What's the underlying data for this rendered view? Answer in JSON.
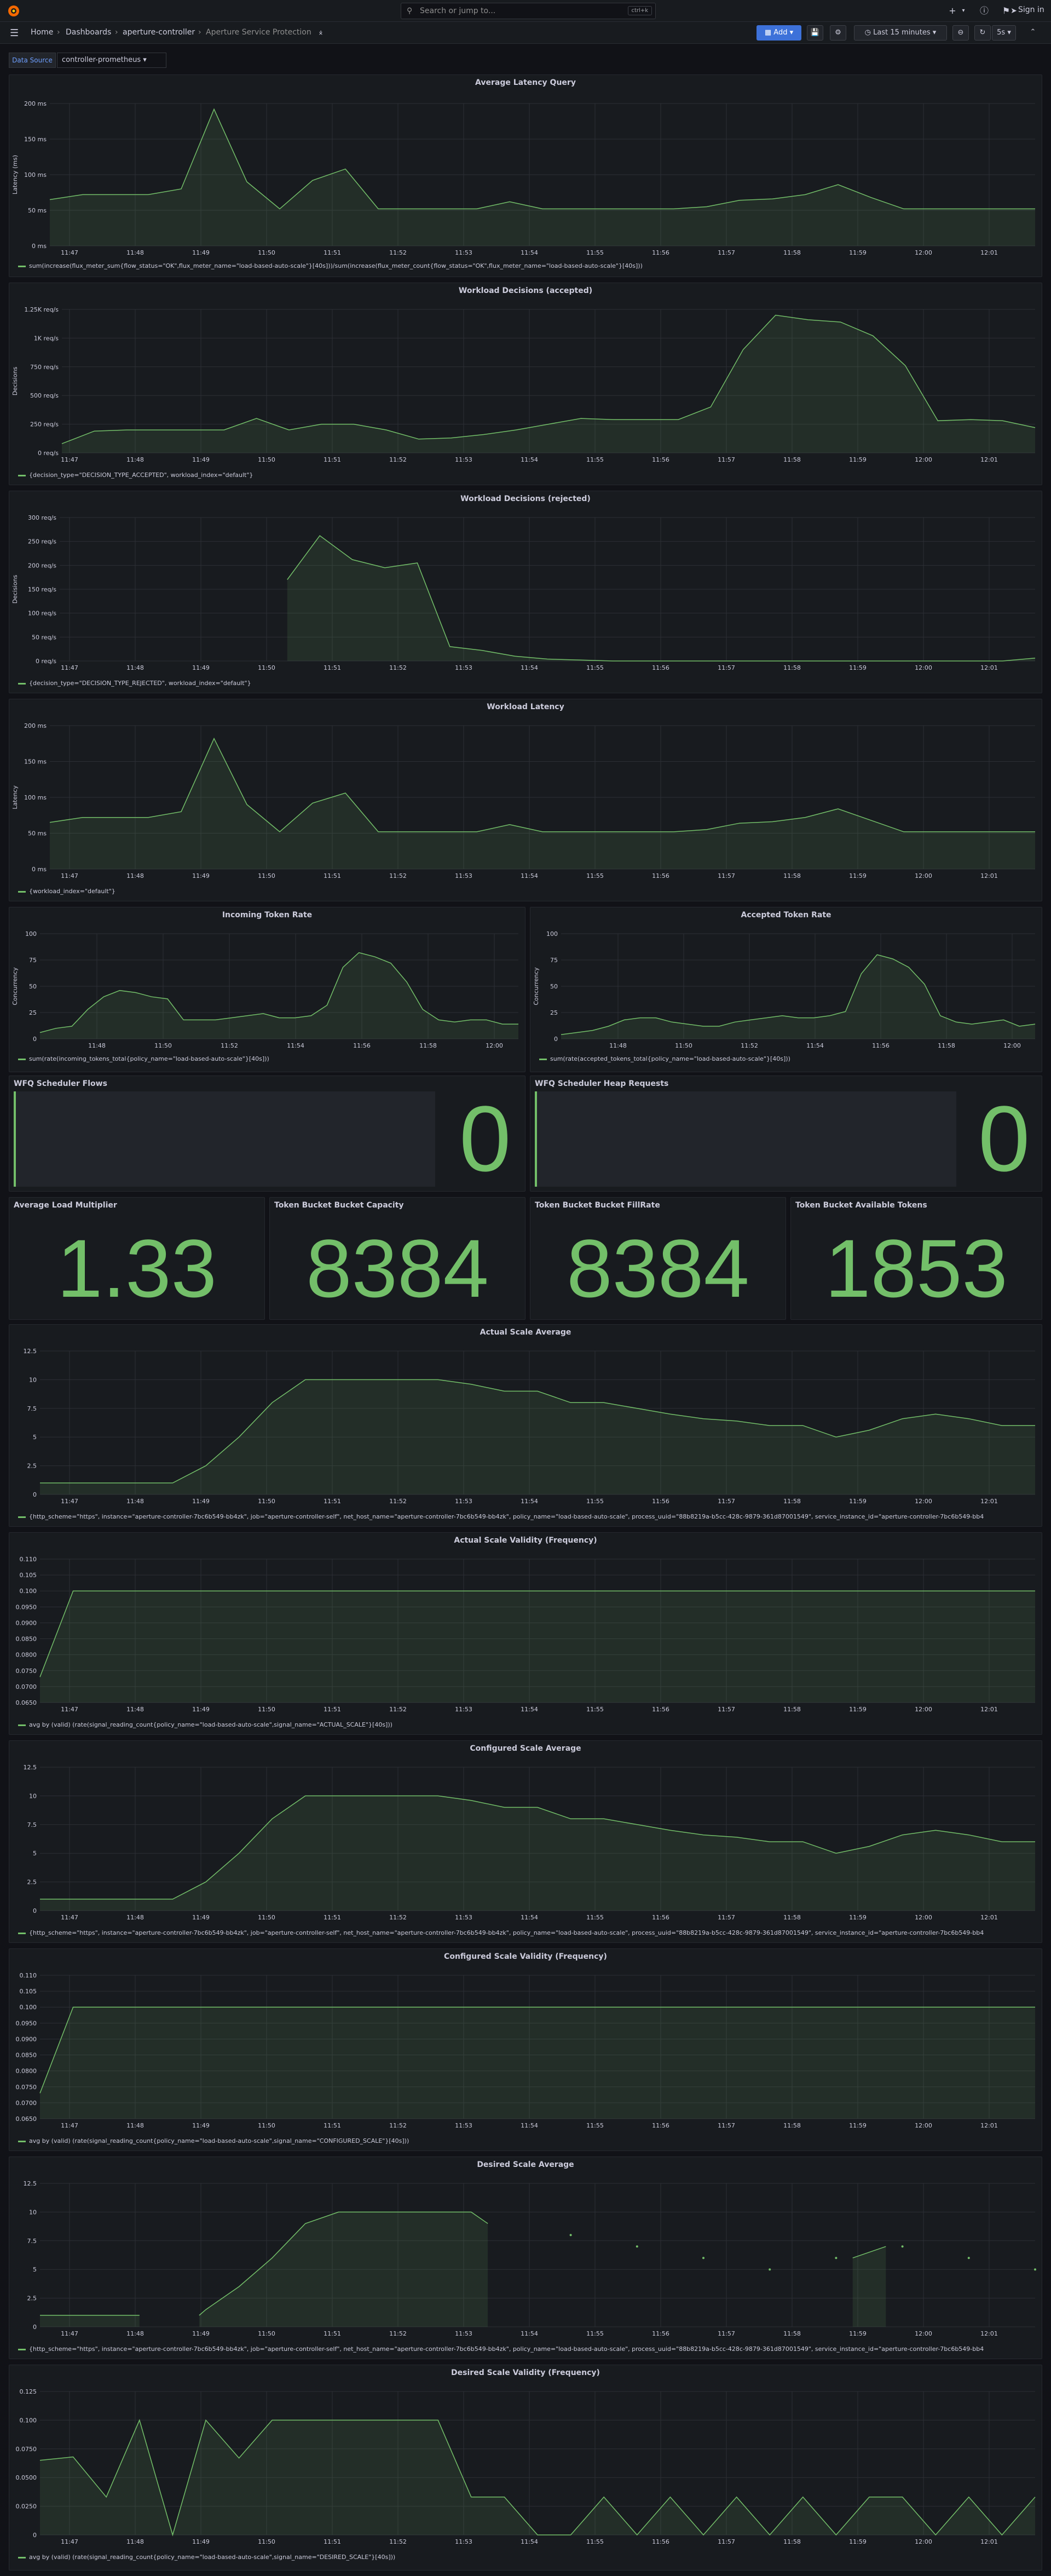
{
  "topnav": {
    "search_placeholder": "Search or jump to...",
    "search_shortcut": "ctrl+k",
    "sign_in": "Sign in"
  },
  "toolbar": {
    "breadcrumbs": [
      "Home",
      "Dashboards",
      "aperture-controller",
      "Aperture Service Protection"
    ],
    "add_label": "Add",
    "time_range": "Last 15 minutes",
    "refresh_interval": "5s"
  },
  "variables": {
    "label": "Data Source",
    "value": "controller-prometheus"
  },
  "colors": {
    "series": "#73bf69",
    "grid": "#2c2f35",
    "text": "#ccccdc",
    "accent": "#6e9fff"
  },
  "time_ticks_hm": [
    "11:47",
    "11:48",
    "11:49",
    "11:50",
    "11:51",
    "11:52",
    "11:53",
    "11:54",
    "11:55",
    "11:56",
    "11:57",
    "11:58",
    "11:59",
    "12:00",
    "12:01"
  ],
  "panels": {
    "avg_latency": {
      "title": "Average Latency Query",
      "legend": "sum(increase(flux_meter_sum{flow_status=\"OK\",flux_meter_name=\"load-based-auto-scale\"}[40s]))/sum(increase(flux_meter_count{flow_status=\"OK\",flux_meter_name=\"load-based-auto-scale\"}[40s]))"
    },
    "decisions_accepted": {
      "title": "Workload Decisions (accepted)",
      "legend": "{decision_type=\"DECISION_TYPE_ACCEPTED\", workload_index=\"default\"}"
    },
    "decisions_rejected": {
      "title": "Workload Decisions (rejected)",
      "legend": "{decision_type=\"DECISION_TYPE_REJECTED\", workload_index=\"default\"}"
    },
    "workload_latency": {
      "title": "Workload Latency",
      "legend": "{workload_index=\"default\"}"
    },
    "incoming_token_rate": {
      "title": "Incoming Token Rate",
      "legend": "sum(rate(incoming_tokens_total{policy_name=\"load-based-auto-scale\"}[40s]))"
    },
    "accepted_token_rate": {
      "title": "Accepted Token Rate",
      "legend": "sum(rate(accepted_tokens_total{policy_name=\"load-based-auto-scale\"}[40s]))"
    },
    "wfq_flows": {
      "title": "WFQ Scheduler Flows",
      "value": "0"
    },
    "wfq_heap": {
      "title": "WFQ Scheduler Heap Requests",
      "value": "0"
    },
    "avg_load_multiplier": {
      "title": "Average Load Multiplier",
      "value": "1.33"
    },
    "bucket_capacity": {
      "title": "Token Bucket Bucket Capacity",
      "value": "8384"
    },
    "bucket_fillrate": {
      "title": "Token Bucket Bucket FillRate",
      "value": "8384"
    },
    "bucket_available": {
      "title": "Token Bucket Available Tokens",
      "value": "1853"
    },
    "actual_scale_avg": {
      "title": "Actual Scale Average",
      "legend": "{http_scheme=\"https\", instance=\"aperture-controller-7bc6b549-bb4zk\", job=\"aperture-controller-self\", net_host_name=\"aperture-controller-7bc6b549-bb4zk\", policy_name=\"load-based-auto-scale\", process_uuid=\"88b8219a-b5cc-428c-9879-361d87001549\", service_instance_id=\"aperture-controller-7bc6b549-bb4"
    },
    "actual_scale_validity": {
      "title": "Actual Scale Validity (Frequency)",
      "legend": "avg by (valid) (rate(signal_reading_count{policy_name=\"load-based-auto-scale\",signal_name=\"ACTUAL_SCALE\"}[40s]))"
    },
    "configured_scale_avg": {
      "title": "Configured Scale Average",
      "legend": "{http_scheme=\"https\", instance=\"aperture-controller-7bc6b549-bb4zk\", job=\"aperture-controller-self\", net_host_name=\"aperture-controller-7bc6b549-bb4zk\", policy_name=\"load-based-auto-scale\", process_uuid=\"88b8219a-b5cc-428c-9879-361d87001549\", service_instance_id=\"aperture-controller-7bc6b549-bb4"
    },
    "configured_scale_validity": {
      "title": "Configured Scale Validity (Frequency)",
      "legend": "avg by (valid) (rate(signal_reading_count{policy_name=\"load-based-auto-scale\",signal_name=\"CONFIGURED_SCALE\"}[40s]))"
    },
    "desired_scale_avg": {
      "title": "Desired Scale Average",
      "legend": "{http_scheme=\"https\", instance=\"aperture-controller-7bc6b549-bb4zk\", job=\"aperture-controller-self\", net_host_name=\"aperture-controller-7bc6b549-bb4zk\", policy_name=\"load-based-auto-scale\", process_uuid=\"88b8219a-b5cc-428c-9879-361d87001549\", service_instance_id=\"aperture-controller-7bc6b549-bb4"
    },
    "desired_scale_validity": {
      "title": "Desired Scale Validity (Frequency)",
      "legend": "avg by (valid) (rate(signal_reading_count{policy_name=\"load-based-auto-scale\",signal_name=\"DESIRED_SCALE\"}[40s]))"
    }
  },
  "chart_data": [
    {
      "id": "avg_latency",
      "type": "area",
      "ylabel": "Latency (ms)",
      "ylim": [
        0,
        200
      ],
      "yticks": [
        "0 ms",
        "50 ms",
        "100 ms",
        "150 ms",
        "200 ms"
      ],
      "ytick_values": [
        0,
        50,
        100,
        150,
        200
      ],
      "x": [
        0,
        1,
        2,
        3,
        4,
        5,
        6,
        7,
        8,
        9,
        10,
        11,
        12,
        13,
        14,
        15,
        16,
        17,
        18,
        19,
        20,
        21,
        22,
        23,
        24,
        25,
        26,
        27,
        28,
        29,
        30
      ],
      "values": [
        65,
        72,
        72,
        72,
        80,
        192,
        90,
        52,
        92,
        108,
        52,
        52,
        52,
        52,
        62,
        52,
        52,
        52,
        52,
        52,
        55,
        64,
        66,
        72,
        86,
        68,
        52,
        52,
        52,
        52,
        52
      ]
    },
    {
      "id": "decisions_accepted",
      "type": "area",
      "ylabel": "Decisions",
      "ylim": [
        0,
        1250
      ],
      "yticks": [
        "0 req/s",
        "250 req/s",
        "500 req/s",
        "750 req/s",
        "1K req/s",
        "1.25K req/s"
      ],
      "ytick_values": [
        0,
        250,
        500,
        750,
        1000,
        1250
      ],
      "x": [
        0,
        1,
        2,
        3,
        4,
        5,
        6,
        7,
        8,
        9,
        10,
        11,
        12,
        13,
        14,
        15,
        16,
        17,
        18,
        19,
        20,
        21,
        22,
        23,
        24,
        25,
        26,
        27,
        28,
        29,
        30
      ],
      "values": [
        80,
        190,
        200,
        200,
        200,
        200,
        300,
        200,
        250,
        250,
        200,
        120,
        130,
        160,
        200,
        250,
        300,
        290,
        290,
        290,
        400,
        900,
        1200,
        1160,
        1140,
        1020,
        760,
        280,
        290,
        280,
        220
      ]
    },
    {
      "id": "decisions_rejected",
      "type": "area",
      "ylabel": "Decisions",
      "ylim": [
        0,
        300
      ],
      "yticks": [
        "0 req/s",
        "50 req/s",
        "100 req/s",
        "150 req/s",
        "200 req/s",
        "250 req/s",
        "300 req/s"
      ],
      "ytick_values": [
        0,
        50,
        100,
        150,
        200,
        250,
        300
      ],
      "x": [
        7,
        8,
        9,
        10,
        11,
        12,
        13,
        14,
        15,
        16,
        17,
        18,
        19,
        20,
        21,
        22,
        23,
        24,
        25,
        26,
        27,
        28,
        29,
        30
      ],
      "values": [
        170,
        262,
        212,
        195,
        205,
        30,
        22,
        10,
        4,
        2,
        0,
        0,
        0,
        0,
        0,
        0,
        0,
        0,
        0,
        0,
        0,
        0,
        0,
        6
      ]
    },
    {
      "id": "workload_latency",
      "type": "area",
      "ylabel": "Latency",
      "ylim": [
        0,
        200
      ],
      "yticks": [
        "0 ms",
        "50 ms",
        "100 ms",
        "150 ms",
        "200 ms"
      ],
      "ytick_values": [
        0,
        50,
        100,
        150,
        200
      ],
      "x": [
        0,
        1,
        2,
        3,
        4,
        5,
        6,
        7,
        8,
        9,
        10,
        11,
        12,
        13,
        14,
        15,
        16,
        17,
        18,
        19,
        20,
        21,
        22,
        23,
        24,
        25,
        26,
        27,
        28,
        29,
        30
      ],
      "values": [
        65,
        72,
        72,
        72,
        80,
        182,
        90,
        52,
        92,
        106,
        52,
        52,
        52,
        52,
        62,
        52,
        52,
        52,
        52,
        52,
        55,
        64,
        66,
        72,
        84,
        68,
        52,
        52,
        52,
        52,
        52
      ]
    },
    {
      "id": "incoming_token_rate",
      "type": "area",
      "ylabel": "Concurrency",
      "ylim": [
        0,
        100
      ],
      "yticks": [
        "0",
        "25",
        "50",
        "75",
        "100"
      ],
      "ytick_values": [
        0,
        25,
        50,
        75,
        100
      ],
      "xticks": [
        "11:48",
        "11:50",
        "11:52",
        "11:54",
        "11:56",
        "11:58",
        "12:00"
      ],
      "x": [
        0,
        1,
        2,
        3,
        4,
        5,
        6,
        7,
        8,
        9,
        10,
        11,
        12,
        13,
        14,
        15,
        16,
        17,
        18,
        19,
        20,
        21,
        22,
        23,
        24,
        25,
        26,
        27,
        28,
        29,
        30
      ],
      "values": [
        6,
        10,
        12,
        28,
        40,
        46,
        44,
        40,
        38,
        18,
        18,
        18,
        20,
        22,
        24,
        20,
        20,
        22,
        32,
        68,
        82,
        78,
        72,
        54,
        28,
        18,
        16,
        18,
        18,
        14,
        14
      ]
    },
    {
      "id": "accepted_token_rate",
      "type": "area",
      "ylabel": "Concurrency",
      "ylim": [
        0,
        100
      ],
      "yticks": [
        "0",
        "25",
        "50",
        "75",
        "100"
      ],
      "ytick_values": [
        0,
        25,
        50,
        75,
        100
      ],
      "xticks": [
        "11:48",
        "11:50",
        "11:52",
        "11:54",
        "11:56",
        "11:58",
        "12:00"
      ],
      "x": [
        0,
        1,
        2,
        3,
        4,
        5,
        6,
        7,
        8,
        9,
        10,
        11,
        12,
        13,
        14,
        15,
        16,
        17,
        18,
        19,
        20,
        21,
        22,
        23,
        24,
        25,
        26,
        27,
        28,
        29,
        30
      ],
      "values": [
        4,
        6,
        8,
        12,
        18,
        20,
        20,
        16,
        14,
        12,
        12,
        16,
        18,
        20,
        22,
        20,
        20,
        22,
        26,
        62,
        80,
        76,
        68,
        52,
        22,
        16,
        14,
        16,
        18,
        12,
        14
      ]
    },
    {
      "id": "actual_scale_avg",
      "type": "area",
      "ylabel": "",
      "ylim": [
        0,
        12.5
      ],
      "yticks": [
        "0",
        "2.5",
        "5",
        "7.5",
        "10",
        "12.5"
      ],
      "ytick_values": [
        0,
        2.5,
        5,
        7.5,
        10,
        12.5
      ],
      "x": [
        0,
        1,
        2,
        3,
        4,
        5,
        6,
        7,
        8,
        9,
        10,
        11,
        12,
        13,
        14,
        15,
        16,
        17,
        18,
        19,
        20,
        21,
        22,
        23,
        24,
        25,
        26,
        27,
        28,
        29,
        30
      ],
      "values": [
        1,
        1,
        1,
        1,
        1,
        2.5,
        5,
        8,
        10,
        10,
        10,
        10,
        10,
        9.6,
        9,
        9,
        8,
        8,
        7.5,
        7,
        6.6,
        6.4,
        6,
        6,
        5,
        5.6,
        6.6,
        7,
        6.6,
        6,
        6
      ]
    },
    {
      "id": "actual_scale_validity",
      "type": "area",
      "ylabel": "",
      "ylim": [
        0.065,
        0.11
      ],
      "yticks": [
        "0.0650",
        "0.0700",
        "0.0750",
        "0.0800",
        "0.0850",
        "0.0900",
        "0.0950",
        "0.100",
        "0.105",
        "0.110"
      ],
      "ytick_values": [
        0.065,
        0.07,
        0.075,
        0.08,
        0.085,
        0.09,
        0.095,
        0.1,
        0.105,
        0.11
      ],
      "x": [
        0,
        1,
        2,
        3,
        4,
        5,
        6,
        7,
        8,
        9,
        10,
        11,
        12,
        13,
        14,
        15,
        16,
        17,
        18,
        19,
        20,
        21,
        22,
        23,
        24,
        25,
        26,
        27,
        28,
        29,
        30
      ],
      "values": [
        0.073,
        0.1,
        0.1,
        0.1,
        0.1,
        0.1,
        0.1,
        0.1,
        0.1,
        0.1,
        0.1,
        0.1,
        0.1,
        0.1,
        0.1,
        0.1,
        0.1,
        0.1,
        0.1,
        0.1,
        0.1,
        0.1,
        0.1,
        0.1,
        0.1,
        0.1,
        0.1,
        0.1,
        0.1,
        0.1,
        0.1
      ]
    },
    {
      "id": "configured_scale_avg",
      "type": "area",
      "ylabel": "",
      "ylim": [
        0,
        12.5
      ],
      "yticks": [
        "0",
        "2.5",
        "5",
        "7.5",
        "10",
        "12.5"
      ],
      "ytick_values": [
        0,
        2.5,
        5,
        7.5,
        10,
        12.5
      ],
      "x": [
        0,
        1,
        2,
        3,
        4,
        5,
        6,
        7,
        8,
        9,
        10,
        11,
        12,
        13,
        14,
        15,
        16,
        17,
        18,
        19,
        20,
        21,
        22,
        23,
        24,
        25,
        26,
        27,
        28,
        29,
        30
      ],
      "values": [
        1,
        1,
        1,
        1,
        1,
        2.5,
        5,
        8,
        10,
        10,
        10,
        10,
        10,
        9.6,
        9,
        9,
        8,
        8,
        7.5,
        7,
        6.6,
        6.4,
        6,
        6,
        5,
        5.6,
        6.6,
        7,
        6.6,
        6,
        6
      ]
    },
    {
      "id": "configured_scale_validity",
      "type": "area",
      "ylabel": "",
      "ylim": [
        0.065,
        0.11
      ],
      "yticks": [
        "0.0650",
        "0.0700",
        "0.0750",
        "0.0800",
        "0.0850",
        "0.0900",
        "0.0950",
        "0.100",
        "0.105",
        "0.110"
      ],
      "ytick_values": [
        0.065,
        0.07,
        0.075,
        0.08,
        0.085,
        0.09,
        0.095,
        0.1,
        0.105,
        0.11
      ],
      "x": [
        0,
        1,
        2,
        3,
        4,
        5,
        6,
        7,
        8,
        9,
        10,
        11,
        12,
        13,
        14,
        15,
        16,
        17,
        18,
        19,
        20,
        21,
        22,
        23,
        24,
        25,
        26,
        27,
        28,
        29,
        30
      ],
      "values": [
        0.073,
        0.1,
        0.1,
        0.1,
        0.1,
        0.1,
        0.1,
        0.1,
        0.1,
        0.1,
        0.1,
        0.1,
        0.1,
        0.1,
        0.1,
        0.1,
        0.1,
        0.1,
        0.1,
        0.1,
        0.1,
        0.1,
        0.1,
        0.1,
        0.1,
        0.1,
        0.1,
        0.1,
        0.1,
        0.1,
        0.1
      ]
    },
    {
      "id": "desired_scale_avg",
      "type": "area",
      "ylabel": "",
      "ylim": [
        0,
        12.5
      ],
      "yticks": [
        "0",
        "2.5",
        "5",
        "7.5",
        "10",
        "12.5"
      ],
      "ytick_values": [
        0,
        2.5,
        5,
        7.5,
        10,
        12.5
      ],
      "segments": [
        {
          "x": [
            0,
            1,
            2,
            3
          ],
          "values": [
            1,
            1,
            1,
            1
          ]
        },
        {
          "x": [
            4.8,
            5,
            6,
            7,
            8,
            9,
            10,
            11,
            12,
            13,
            13.5
          ],
          "values": [
            1,
            1.5,
            3.5,
            6,
            9,
            10,
            10,
            10,
            10,
            10,
            9
          ]
        },
        {
          "x": [
            24.5,
            25.5
          ],
          "values": [
            6,
            7
          ]
        }
      ],
      "points": {
        "x": [
          16,
          18,
          20,
          22,
          24,
          26,
          28,
          30
        ],
        "values": [
          8,
          7,
          6,
          5,
          6,
          7,
          6,
          5
        ]
      }
    },
    {
      "id": "desired_scale_validity",
      "type": "area",
      "ylabel": "",
      "ylim": [
        0,
        0.125
      ],
      "yticks": [
        "0",
        "0.0250",
        "0.0500",
        "0.0750",
        "0.100",
        "0.125"
      ],
      "ytick_values": [
        0,
        0.025,
        0.05,
        0.075,
        0.1,
        0.125
      ],
      "x": [
        0,
        1,
        2,
        3,
        4,
        5,
        6,
        7,
        8,
        9,
        10,
        11,
        12,
        13,
        14,
        15,
        16,
        17,
        18,
        19,
        20,
        21,
        22,
        23,
        24,
        25,
        26,
        27,
        28,
        29,
        30
      ],
      "values": [
        0.065,
        0.068,
        0.033,
        0.1,
        0,
        0.1,
        0.067,
        0.1,
        0.1,
        0.1,
        0.1,
        0.1,
        0.1,
        0.033,
        0.033,
        0,
        0,
        0.033,
        0,
        0.033,
        0,
        0.033,
        0,
        0.033,
        0,
        0.033,
        0.033,
        0,
        0.033,
        0,
        0.033
      ]
    }
  ]
}
